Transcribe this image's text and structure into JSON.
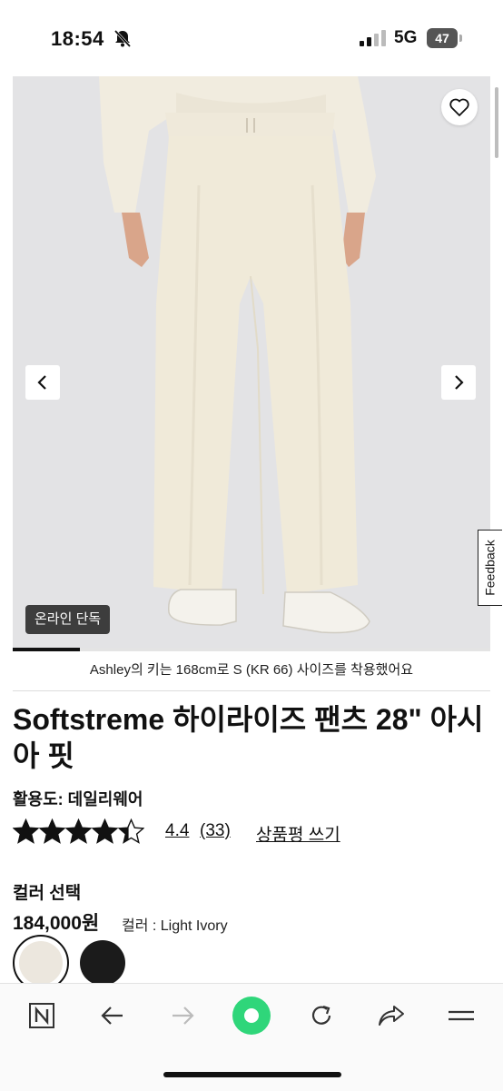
{
  "status": {
    "time": "18:54",
    "network": "5G",
    "battery": "47"
  },
  "gallery": {
    "badge": "온라인 단독",
    "caption": "Ashley의 키는 168cm로 S (KR 66) 사이즈를 착용했어요",
    "slide_progress": 0.14
  },
  "feedback": "Feedback",
  "product": {
    "title": "Softstreme 하이라이즈 팬츠 28\" 아시아 핏",
    "usage": "활용도: 데일리웨어",
    "rating": "4.4",
    "rating_value": 4.4,
    "review_count": "(33)",
    "write_review": "상품평 쓰기",
    "color_heading": "컬러 선택",
    "price": "184,000원",
    "color_label": "컬러 : Light Ivory",
    "swatches": [
      {
        "name": "Light Ivory",
        "color": "#ece7de",
        "selected": true
      },
      {
        "name": "Black",
        "color": "#1b1b1b",
        "selected": false
      }
    ]
  },
  "toolbar": {
    "icons": [
      "n-tab-icon",
      "back-arrow-icon",
      "forward-arrow-icon",
      "green-dot-icon",
      "reload-icon",
      "share-icon",
      "menu-icon"
    ]
  },
  "colors": {
    "accent_green": "#2fd67a",
    "badge_bg": "#3d3d3d",
    "hero_bg": "#e3e3e5"
  }
}
